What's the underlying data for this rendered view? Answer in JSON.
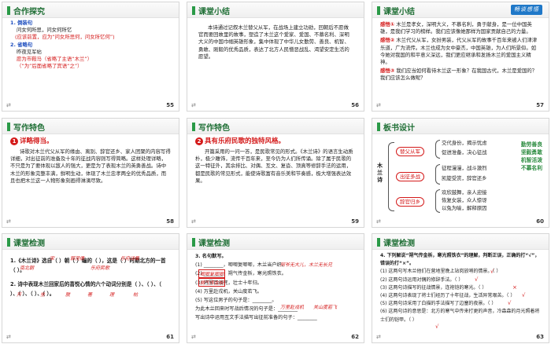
{
  "slides": [
    {
      "title": "合作探究",
      "badge": "合作探究",
      "number": "55",
      "lines": [
        "1. 倒装句",
        "问女何所思，问女何所忆",
        "(应该前置，应为“问女所思何，问女所忆何”)",
        "2. 省略句",
        "昨夜见军帖",
        "愿为市鞍马（省略了主语“木兰”）",
        "（“为”后面省略了宾语“之”）"
      ]
    },
    {
      "title": "课堂小结",
      "number": "56",
      "paragraph": "本诗通过记叙木兰替父从军，在战场上建立功勋，回朝后不愿做官而要回故里的故事，塑造了木兰这个爱家、爱国、不慕名利、深明大义的中国巾帼英雄形象，集中体现了中华儿女勤劳、善良、机智、勇敢、刚毅的优秀品质，表达了北方人民憎恶战乱、渴望安定生活的愿望。"
    },
    {
      "title": "课堂小结",
      "badge": "畅谈感悟",
      "number": "57",
      "items": [
        {
          "label": "感悟①",
          "text": "木兰是孝女，深明大义，不慕名利，勇于献身，是一位中国英雄，是我们学习的榜样。我们应该像她那样为国家贡献自己的力量。"
        },
        {
          "label": "感悟②",
          "text": "木兰代父从军，女扮男装，代父从军的故事千百年来被人们津津乐道，广为流传。木兰也成为女中豪杰，中国英雄，为人们所景仰。如今她对我国的和平意义深远，我们更应继承和发扬木兰的爱国主义精神。"
        },
        {
          "label": "感悟③",
          "text": "我们应当如何看待木兰这一形象？在我国古代，木兰是爱国的？我们应该怎么做呢？"
        }
      ]
    },
    {
      "title": "写作特色",
      "number": "58",
      "heading_num": "1",
      "heading": "详略得当。",
      "paragraph": "诗歌对木兰代父从军的缘由、离别、辞官还乡、家人团聚的内容写得详细，对出征前的准备及十年的征战内容则写得简略。这样处理详略，不只是为了要体现以敌人的强大，更是为了表现木兰的英勇善战。诗中木兰的形象完整丰满，鲜明生动，体现了木兰忠孝两全的优秀品质，而且也把木兰这一人物形象刻画得淋漓尽致。"
    },
    {
      "title": "写作特色",
      "number": "59",
      "heading_num": "2",
      "heading": "具有乐府民歌的独特风格。",
      "paragraph": "开篇采用的一问一答，是民歌常见的形式。《木兰诗》的语言生动质朴，极少雕饰，流传千百年来，至今仍为人们所传诵。除了属于民歌的这一特征外，其余排比、对偶、互文、复沓、顶真等修辞手法的运用，都是民歌的常见形式，能使诗歌富有音乐美和节奏感，极大增强表达效果。"
    },
    {
      "title": "板书设计",
      "number": "60",
      "vertical": "木兰诗",
      "pills": [
        "替父从军",
        "出征多战",
        "辞官归乡"
      ],
      "texts": [
        "交代身份，揭示忧虑",
        "促进准备，决心征战",
        "征程漫漫，战斗激烈",
        "凯旋受赏，辞官还乡",
        "欢欣鼓舞，亲人迎接",
        "恢复女装，众人惊讶",
        "以兔为喻，解释原因"
      ],
      "right": [
        "勤劳善良",
        "坚毅勇敢",
        "机智活泼",
        "不慕名利"
      ]
    },
    {
      "title": "课堂检测",
      "number": "61",
      "lines": [
        "1.《木兰诗》选自（   ）朝（   ）编的（   ），这是（   ）时期北方的一首（   ）。",
        "2. 诗中表现木兰回家后的喜悦心情的六个动词分别是（   ）、（   ）、（   ）、（   ）、（   ）、（   ）。"
      ],
      "answers": [
        "宋",
        "郭茂倩",
        "乐府诗集",
        "南北朝",
        "乐府民歌",
        "开",
        "坐",
        "脱",
        "著",
        "理",
        "帖"
      ]
    },
    {
      "title": "课堂检测",
      "number": "62",
      "lines": [
        "3. 名句默写。",
        "(1) ________，唧唧复唧唧，木兰当户织。",
        "(2) ________，朔气传金柝，寒光照铁衣。",
        "(3) 将军百战死，壮士十年归。",
        "(4) 万里赴戎机，关山度若飞。",
        "(5) 写这位男子的句子是：________。",
        "为此木兰回来时写战后情况的句子是：________",
        "写出诗中运用互文手法描写出征前准备的句子：________"
      ],
      "answers": [
        "唧唧复唧唧",
        "朔气传金柝",
        "阿爷无大儿，木兰无长兄",
        "万里赴戎机",
        "关山度若飞"
      ]
    },
    {
      "title": "课堂检测",
      "number": "63",
      "lines": [
        "4. 下列解说“朔气传金柝，寒光照铁衣”的理解，判断正误，正确的打“√”，错误的打“×”。",
        "(1) 这两句写木兰他们在营地里晚上站岗放哨的情景。（   ）",
        "(2) 这两句诗运用对偶的修辞手法。（   ）",
        "(3) 这两句诗描写的征战情景，连袍铠的寒光。（   ）",
        "(4) 这两句诗表现了将士们经历了十年征战，生活异常艰苦。（   ）",
        "(5) 这两句诗采用了白描的手法描写了边塞的夜景。（   ）",
        "(6) 这两句诗的意思是：北方的寒气中传来打更的声音，冷森森的月光照着将士们的铠甲。（   ）"
      ],
      "answers": [
        "√",
        "√",
        "×",
        "√",
        "√",
        "√"
      ]
    }
  ]
}
